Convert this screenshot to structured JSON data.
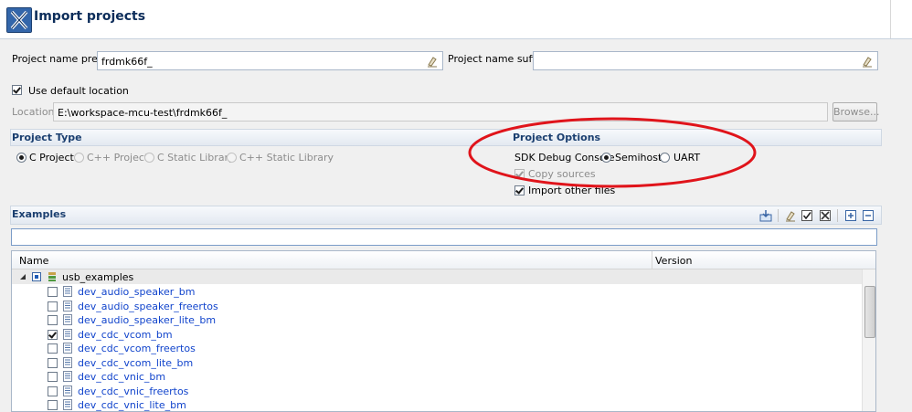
{
  "dialog": {
    "title": "Import projects"
  },
  "prefix": {
    "label": "Project name prefix:",
    "value": "frdmk66f_"
  },
  "suffix": {
    "label": "Project name suffix:",
    "value": ""
  },
  "use_default_location": {
    "label": "Use default location",
    "checked": true
  },
  "location": {
    "label": "Location:",
    "value": "E:\\workspace-mcu-test\\frdmk66f_",
    "browse_label": "Browse..."
  },
  "project_type": {
    "title": "Project Type",
    "options": [
      {
        "label": "C Project",
        "selected": true
      },
      {
        "label": "C++ Project",
        "selected": false
      },
      {
        "label": "C Static Library",
        "selected": false
      },
      {
        "label": "C++ Static Library",
        "selected": false
      }
    ]
  },
  "project_options": {
    "title": "Project Options",
    "sdk_debug_console_label": "SDK Debug Console",
    "console_options": [
      {
        "label": "Semihost",
        "selected": true
      },
      {
        "label": "UART",
        "selected": false
      }
    ],
    "copy_sources": {
      "label": "Copy sources",
      "checked": true,
      "disabled": true
    },
    "import_other_files": {
      "label": "Import other files",
      "checked": true
    }
  },
  "examples": {
    "title": "Examples",
    "filter_value": "",
    "columns": [
      "Name",
      "Version"
    ],
    "group": {
      "label": "usb_examples"
    },
    "items": [
      {
        "label": "dev_audio_speaker_bm",
        "checked": false
      },
      {
        "label": "dev_audio_speaker_freertos",
        "checked": false
      },
      {
        "label": "dev_audio_speaker_lite_bm",
        "checked": false
      },
      {
        "label": "dev_cdc_vcom_bm",
        "checked": true
      },
      {
        "label": "dev_cdc_vcom_freertos",
        "checked": false
      },
      {
        "label": "dev_cdc_vcom_lite_bm",
        "checked": false
      },
      {
        "label": "dev_cdc_vnic_bm",
        "checked": false
      },
      {
        "label": "dev_cdc_vnic_freertos",
        "checked": false
      },
      {
        "label": "dev_cdc_vnic_lite_bm",
        "checked": false
      }
    ]
  },
  "colors": {
    "annotation": "#e0141b",
    "link": "#1144cc",
    "header_title": "#0c2d5a"
  }
}
